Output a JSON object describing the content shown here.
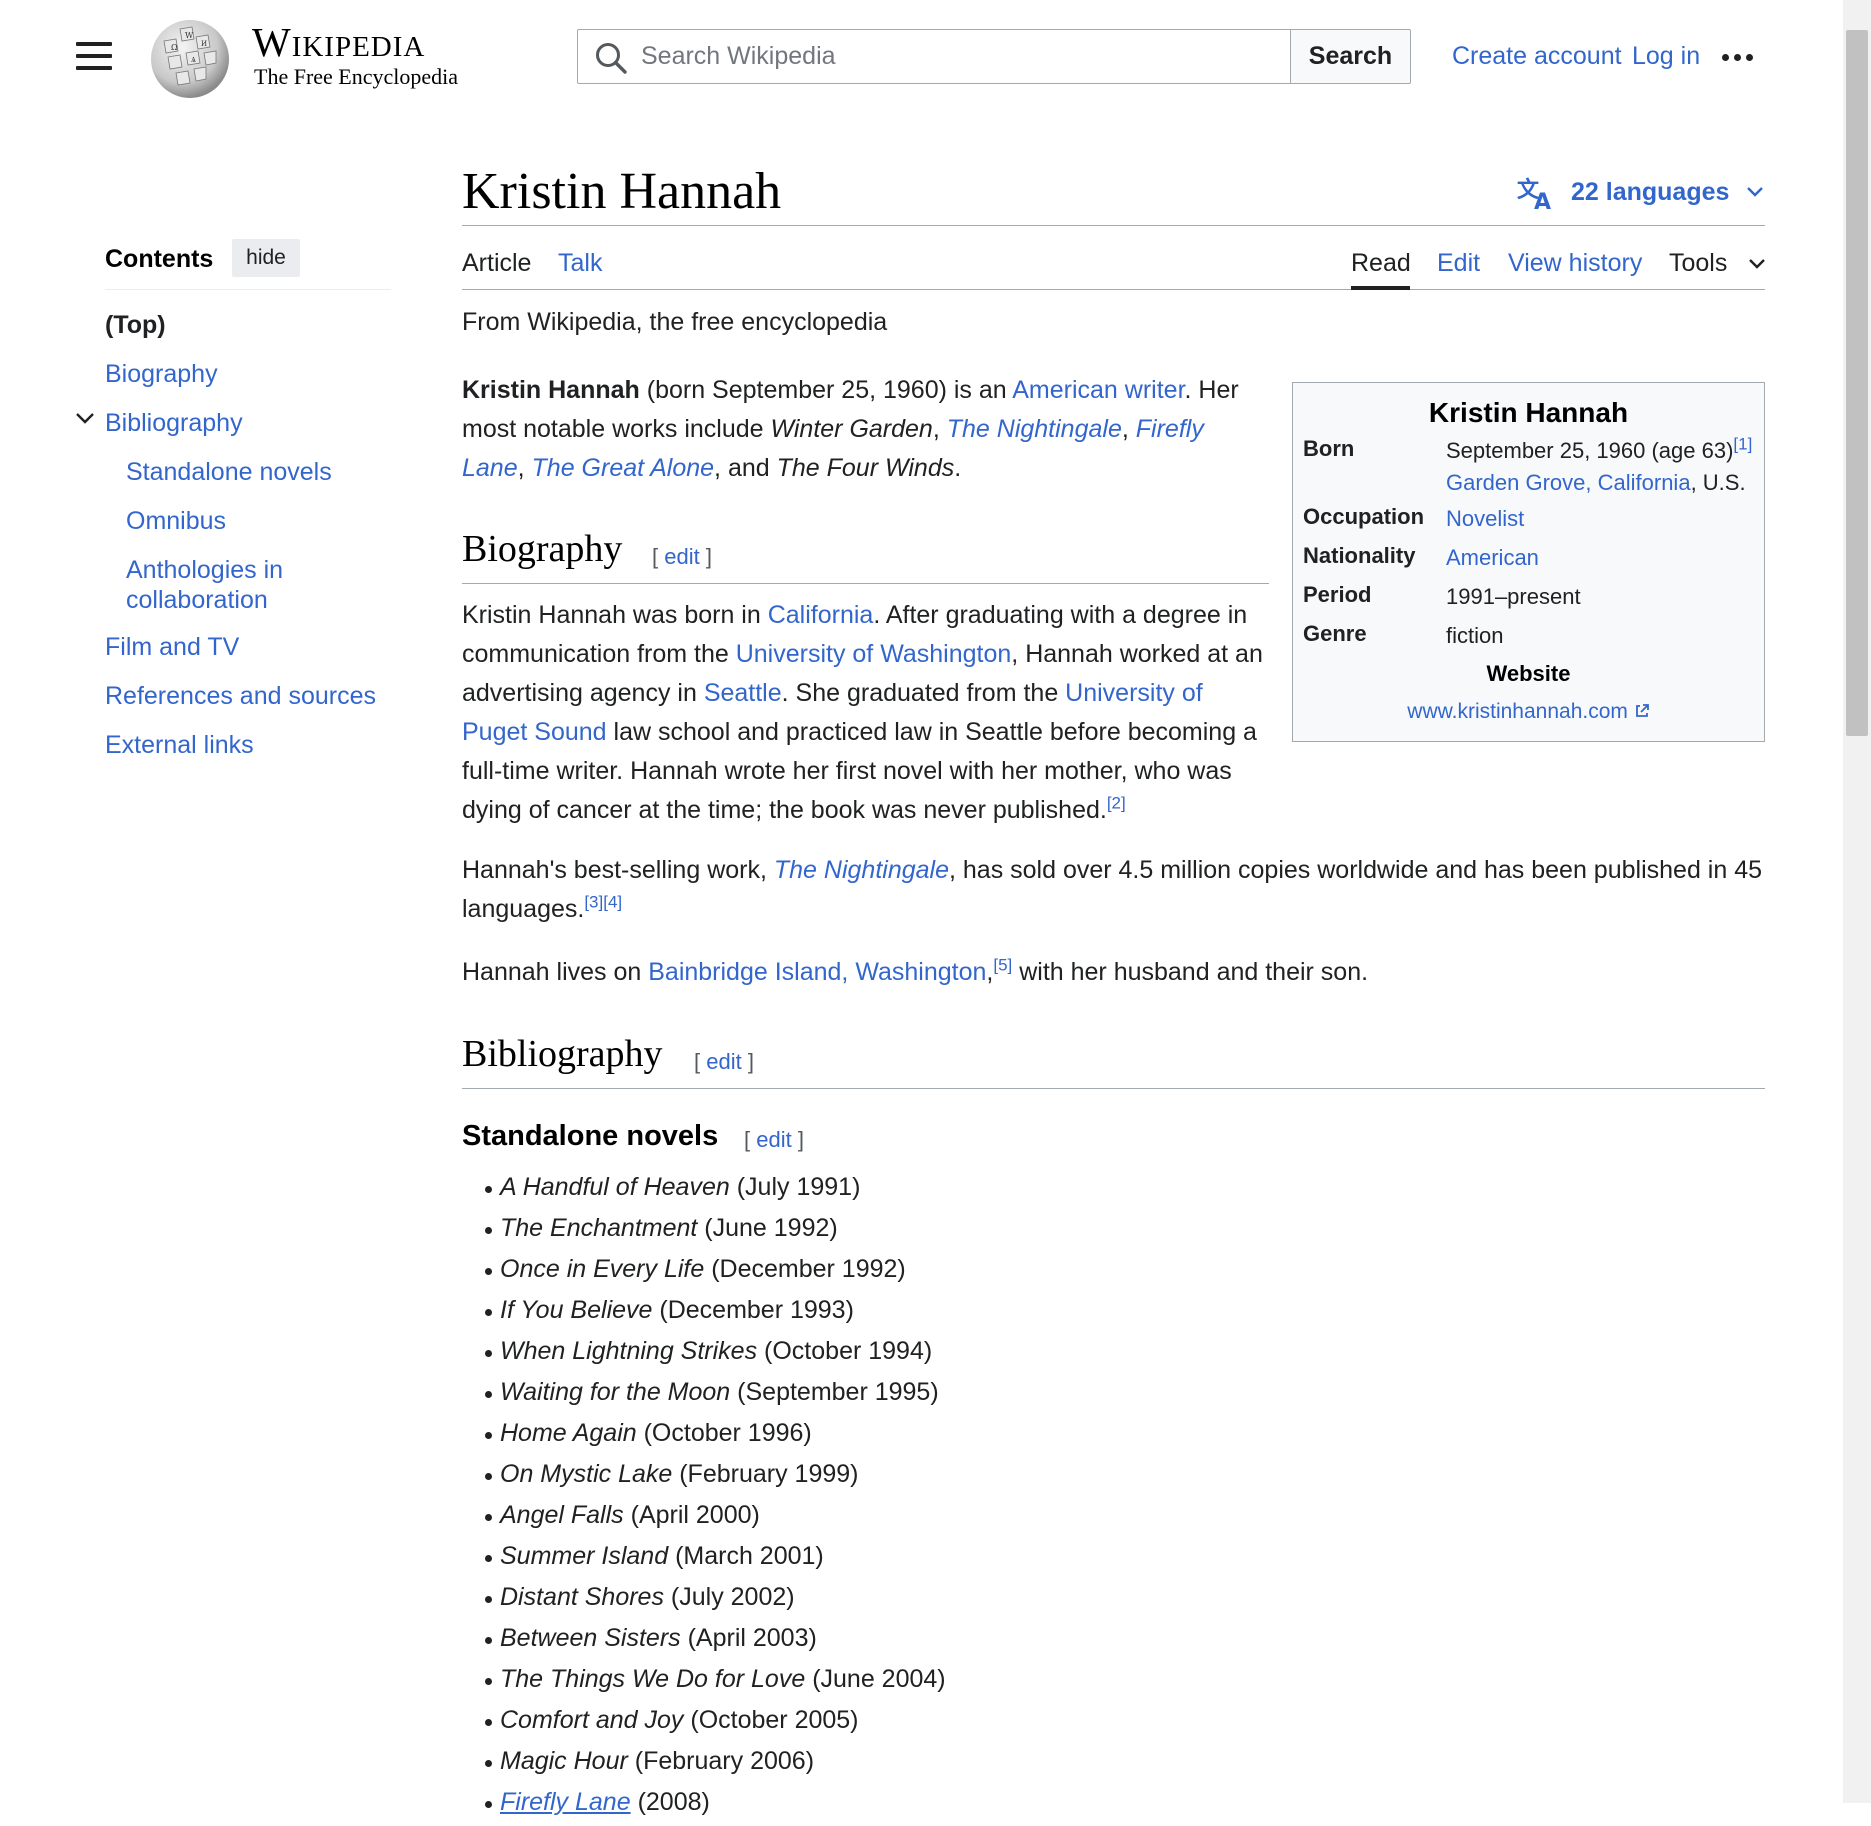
{
  "header": {
    "wordmark_title": "Wikipedia",
    "wordmark_tagline": "The Free Encyclopedia",
    "search_placeholder": "Search Wikipedia",
    "search_button": "Search",
    "create_account": "Create account",
    "log_in": "Log in"
  },
  "page": {
    "title": "Kristin Hannah",
    "languages": "22 languages",
    "tabs": {
      "article": "Article",
      "talk": "Talk",
      "read": "Read",
      "edit": "Edit",
      "history": "View history",
      "tools": "Tools"
    },
    "tagline": "From Wikipedia, the free encyclopedia"
  },
  "toc": {
    "title": "Contents",
    "hide": "hide",
    "items": [
      "(Top)",
      "Biography",
      "Bibliography",
      "Standalone novels",
      "Omnibus",
      "Anthologies in collaboration",
      "Film and TV",
      "References and sources",
      "External links"
    ]
  },
  "intro": {
    "name": "Kristin Hannah",
    "t1": " (born September 25, 1960) is an ",
    "l1": "American writer",
    "t2": ". Her most notable works include ",
    "w1": "Winter Garden",
    "c1": ", ",
    "w2": "The Nightingale",
    "c2": ", ",
    "w3": "Firefly Lane",
    "c3": ", ",
    "w4": "The Great Alone",
    "t3": ", and ",
    "w5": "The Four Winds",
    "t4": "."
  },
  "biography": {
    "heading": "Biography",
    "edit": "edit",
    "p1": {
      "a": "Kristin Hannah was born in ",
      "l1": "California",
      "b": ". After graduating with a degree in communication from the ",
      "l2": "University of Washington",
      "c": ", Hannah worked at an advertising agency in ",
      "l3": "Seattle",
      "d": ". She graduated from the ",
      "l4": "University of Puget Sound",
      "e": " law school and practiced law in Seattle before becoming a full-time writer. Hannah wrote her first novel with her mother, who was dying of cancer at the time; the book was never published.",
      "ref": "[2]"
    },
    "p2": {
      "a": "Hannah's best-selling work, ",
      "l1": "The Nightingale",
      "b": ", has sold over 4.5 million copies worldwide and has been published in 45 languages.",
      "ref1": "[3]",
      "ref2": "[4]"
    },
    "p3": {
      "a": "Hannah lives on ",
      "l1": "Bainbridge Island, Washington",
      "b": ",",
      "ref": "[5]",
      "c": " with her husband and their son."
    }
  },
  "bibliography": {
    "heading": "Bibliography",
    "edit": "edit",
    "sub_heading": "Standalone novels",
    "sub_edit": "edit",
    "books": [
      {
        "title": "A Handful of Heaven",
        "date": " (July 1991)"
      },
      {
        "title": "The Enchantment",
        "date": " (June 1992)"
      },
      {
        "title": "Once in Every Life",
        "date": " (December 1992)"
      },
      {
        "title": "If You Believe",
        "date": " (December 1993)"
      },
      {
        "title": "When Lightning Strikes",
        "date": " (October 1994)"
      },
      {
        "title": "Waiting for the Moon",
        "date": " (September 1995)"
      },
      {
        "title": "Home Again",
        "date": " (October 1996)"
      },
      {
        "title": "On Mystic Lake",
        "date": " (February 1999)"
      },
      {
        "title": "Angel Falls",
        "date": " (April 2000)"
      },
      {
        "title": "Summer Island",
        "date": " (March 2001)"
      },
      {
        "title": "Distant Shores",
        "date": " (July 2002)"
      },
      {
        "title": "Between Sisters",
        "date": " (April 2003)"
      },
      {
        "title": "The Things We Do for Love",
        "date": " (June 2004)"
      },
      {
        "title": "Comfort and Joy",
        "date": " (October 2005)"
      },
      {
        "title": "Magic Hour",
        "date": " (February 2006)"
      },
      {
        "title": "Firefly Lane",
        "date": " (2008)"
      }
    ]
  },
  "infobox": {
    "title": "Kristin Hannah",
    "born_label": "Born",
    "born_value": "September 25, 1960 (age 63)",
    "born_ref": "[1]",
    "born_place": "Garden Grove, California",
    "born_country": ", U.S.",
    "occupation_label": "Occupation",
    "occupation_value": "Novelist",
    "nationality_label": "Nationality",
    "nationality_value": "American",
    "period_label": "Period",
    "period_value": "1991–present",
    "genre_label": "Genre",
    "genre_value": "fiction",
    "website_label": "Website",
    "website_value": "www.kristinhannah.com"
  },
  "colors": {
    "link": "#3366cc",
    "text": "#202122",
    "border": "#a2a9b1",
    "infobox_bg": "#f8f9fa"
  },
  "icons": [
    "menu-icon",
    "wikipedia-globe-logo",
    "search-icon",
    "more-options-icon",
    "language-icon",
    "chevron-down-icon",
    "external-link-icon"
  ]
}
